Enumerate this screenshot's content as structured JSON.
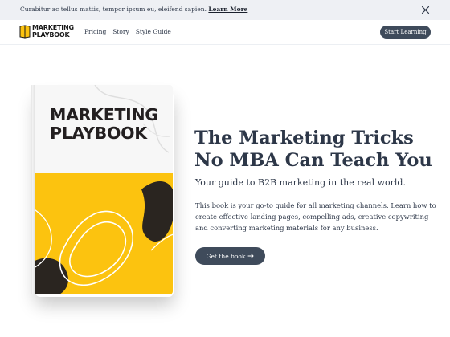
{
  "announcement": {
    "text": "Curabitur ac tellus mattis, tempor ipsum eu, eleifend sapien.",
    "link": "Learn More",
    "close_icon": "close-icon"
  },
  "nav": {
    "logo_line1": "MARKETING",
    "logo_line2": "PLAYBOOK",
    "links": [
      "Pricing",
      "Story",
      "Style Guide"
    ],
    "cta": "Start Learning"
  },
  "book": {
    "title_line1": "MARKETING",
    "title_line2": "PLAYBOOK",
    "cover_colors": {
      "top": "#f7f7f7",
      "bottom": "#fcc30f",
      "spine": "#e9e9e9",
      "blob": "#2a2520"
    }
  },
  "hero": {
    "headline": "The Marketing Tricks No MBA Can Teach You",
    "subheadline": "Your guide to B2B marketing in the real world.",
    "body": "This book is your go-to guide for all marketing channels. Learn how to create effective landing pages, compelling ads, creative copywriting and converting marketing materials for any business.",
    "cta": "Get the book",
    "cta_icon": "arrow-right-icon"
  },
  "colors": {
    "announcement_bg": "#eef0f4",
    "button_bg": "#3f4b5b",
    "text": "#2d3748",
    "brand_yellow": "#fcc30f"
  }
}
